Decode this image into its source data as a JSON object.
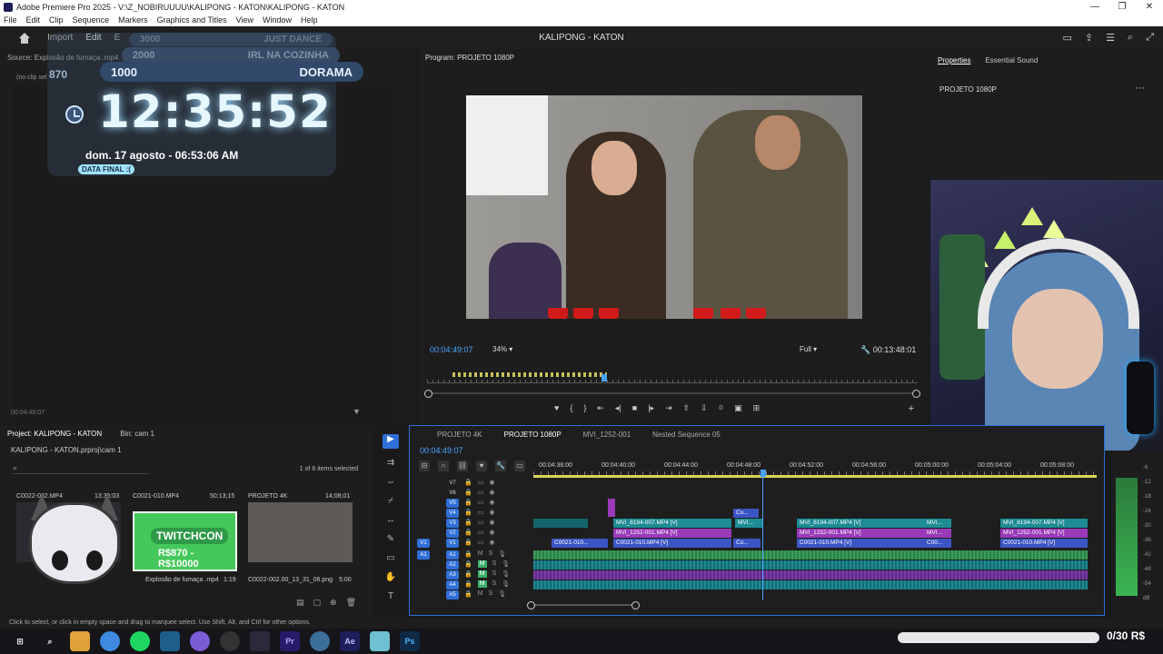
{
  "window": {
    "title": "Adobe Premiere Pro 2025 - V:\\Z_NOBIRUUUU\\KALIPONG - KATON\\KALIPONG - KATON"
  },
  "menu": [
    "File",
    "Edit",
    "Clip",
    "Sequence",
    "Markers",
    "Graphics and Titles",
    "View",
    "Window",
    "Help"
  ],
  "workspace": {
    "tabs": [
      "Import",
      "Edit",
      "E"
    ],
    "active": "Edit",
    "project_name": "KALIPONG - KATON"
  },
  "source": {
    "title": "Source: Explosão de fumaça .mp4",
    "no_clip": "(no clip sel",
    "timecode": "00:04:49:07"
  },
  "overlay": {
    "row1_left": "3000",
    "row1_right": "JUST DANCE",
    "row2_left": "2000",
    "row2_right": "IRL NA COZINHA",
    "row3_left": "1000",
    "row3_right": "DORAMA",
    "left_count": "870",
    "time": "12:35:52",
    "date": "dom. 17 agosto - 06:53:06 AM",
    "final_label": "DATA FINAL :("
  },
  "program": {
    "title": "Program: PROJETO 1080P",
    "timecode": "00:04:49:07",
    "zoom": "34%",
    "quality": "Full",
    "duration": "00:13:48:01"
  },
  "properties": {
    "tab_properties": "Properties",
    "tab_sound": "Essential Sound",
    "sequence": "PROJETO 1080P"
  },
  "project": {
    "tab_project": "Project: KALIPONG - KATON",
    "tab_bin": "Bin: cam 1",
    "file": "KALIPONG - KATON.prproj\\cam 1",
    "selected": "1 of 6 items selected",
    "items": [
      {
        "name": "C0022-002.MP4",
        "duration": "13:35:03"
      },
      {
        "name": "C0021-010.MP4",
        "duration": "50;13;15"
      },
      {
        "name": "PROJETO 4K",
        "duration": "14;08;01"
      },
      {
        "name": "Explosão de fumaça .mp4",
        "duration": "1:19"
      },
      {
        "name": "C0022-002.00_13_31_06.png",
        "duration": "5:00"
      }
    ],
    "twitchcon_label": "TWITCHCON",
    "twitchcon_sub": "R$870 - R$10000"
  },
  "timeline": {
    "tabs": [
      "PROJETO 4K",
      "PROJETO 1080P",
      "MVI_1252-001",
      "Nested Sequence 05"
    ],
    "active": "PROJETO 1080P",
    "timecode": "00:04:49:07",
    "ruler": [
      "00:04:36:00",
      "00:04:40:00",
      "00:04:44:00",
      "00:04:48:00",
      "00:04:52:00",
      "00:04:56:00",
      "00:05:00:00",
      "00:05:04:00",
      "00:05:08:00"
    ],
    "video_tracks": [
      "V7",
      "V6",
      "V5",
      "V4",
      "V3",
      "V2",
      "V1"
    ],
    "audio_tracks": [
      "A1",
      "A2",
      "A3",
      "A4",
      "A5"
    ],
    "clips": {
      "v4_a": "Co...",
      "v3_a": "MVI_8194-007.MP4 [V]",
      "v3_b": "MVI...",
      "v3_c": "MVI_8194-007.MP4 [V]",
      "v3_d": "MVI...",
      "v3_e": "MVI_8194-007.MP4 [V]",
      "v2_a": "MVI_1252-001.MP4 [V]",
      "v2_b": "MVI_1252-001.MP4 [V]",
      "v2_c": "MVI...",
      "v2_d": "MVI_1252-001.MP4 [V]",
      "v1_a": "C0021-010...",
      "v1_b": "C0021-010.MP4 [V]",
      "v1_c": "Co...",
      "v1_d": "C0021-010.MP4 [V]",
      "v1_e": "C00...",
      "v1_f": "C0021-010.MP4 [V]"
    }
  },
  "meter": {
    "labels": [
      "-6",
      "-12",
      "-18",
      "-24",
      "-30",
      "-36",
      "-42",
      "-48",
      "-54",
      "dB"
    ]
  },
  "status": "Click to select, or click in empty space and drag to marquee select. Use Shift, Alt, and Ctrl for other options.",
  "donation": {
    "text": "0/30 R$",
    "progress": 0.0
  }
}
